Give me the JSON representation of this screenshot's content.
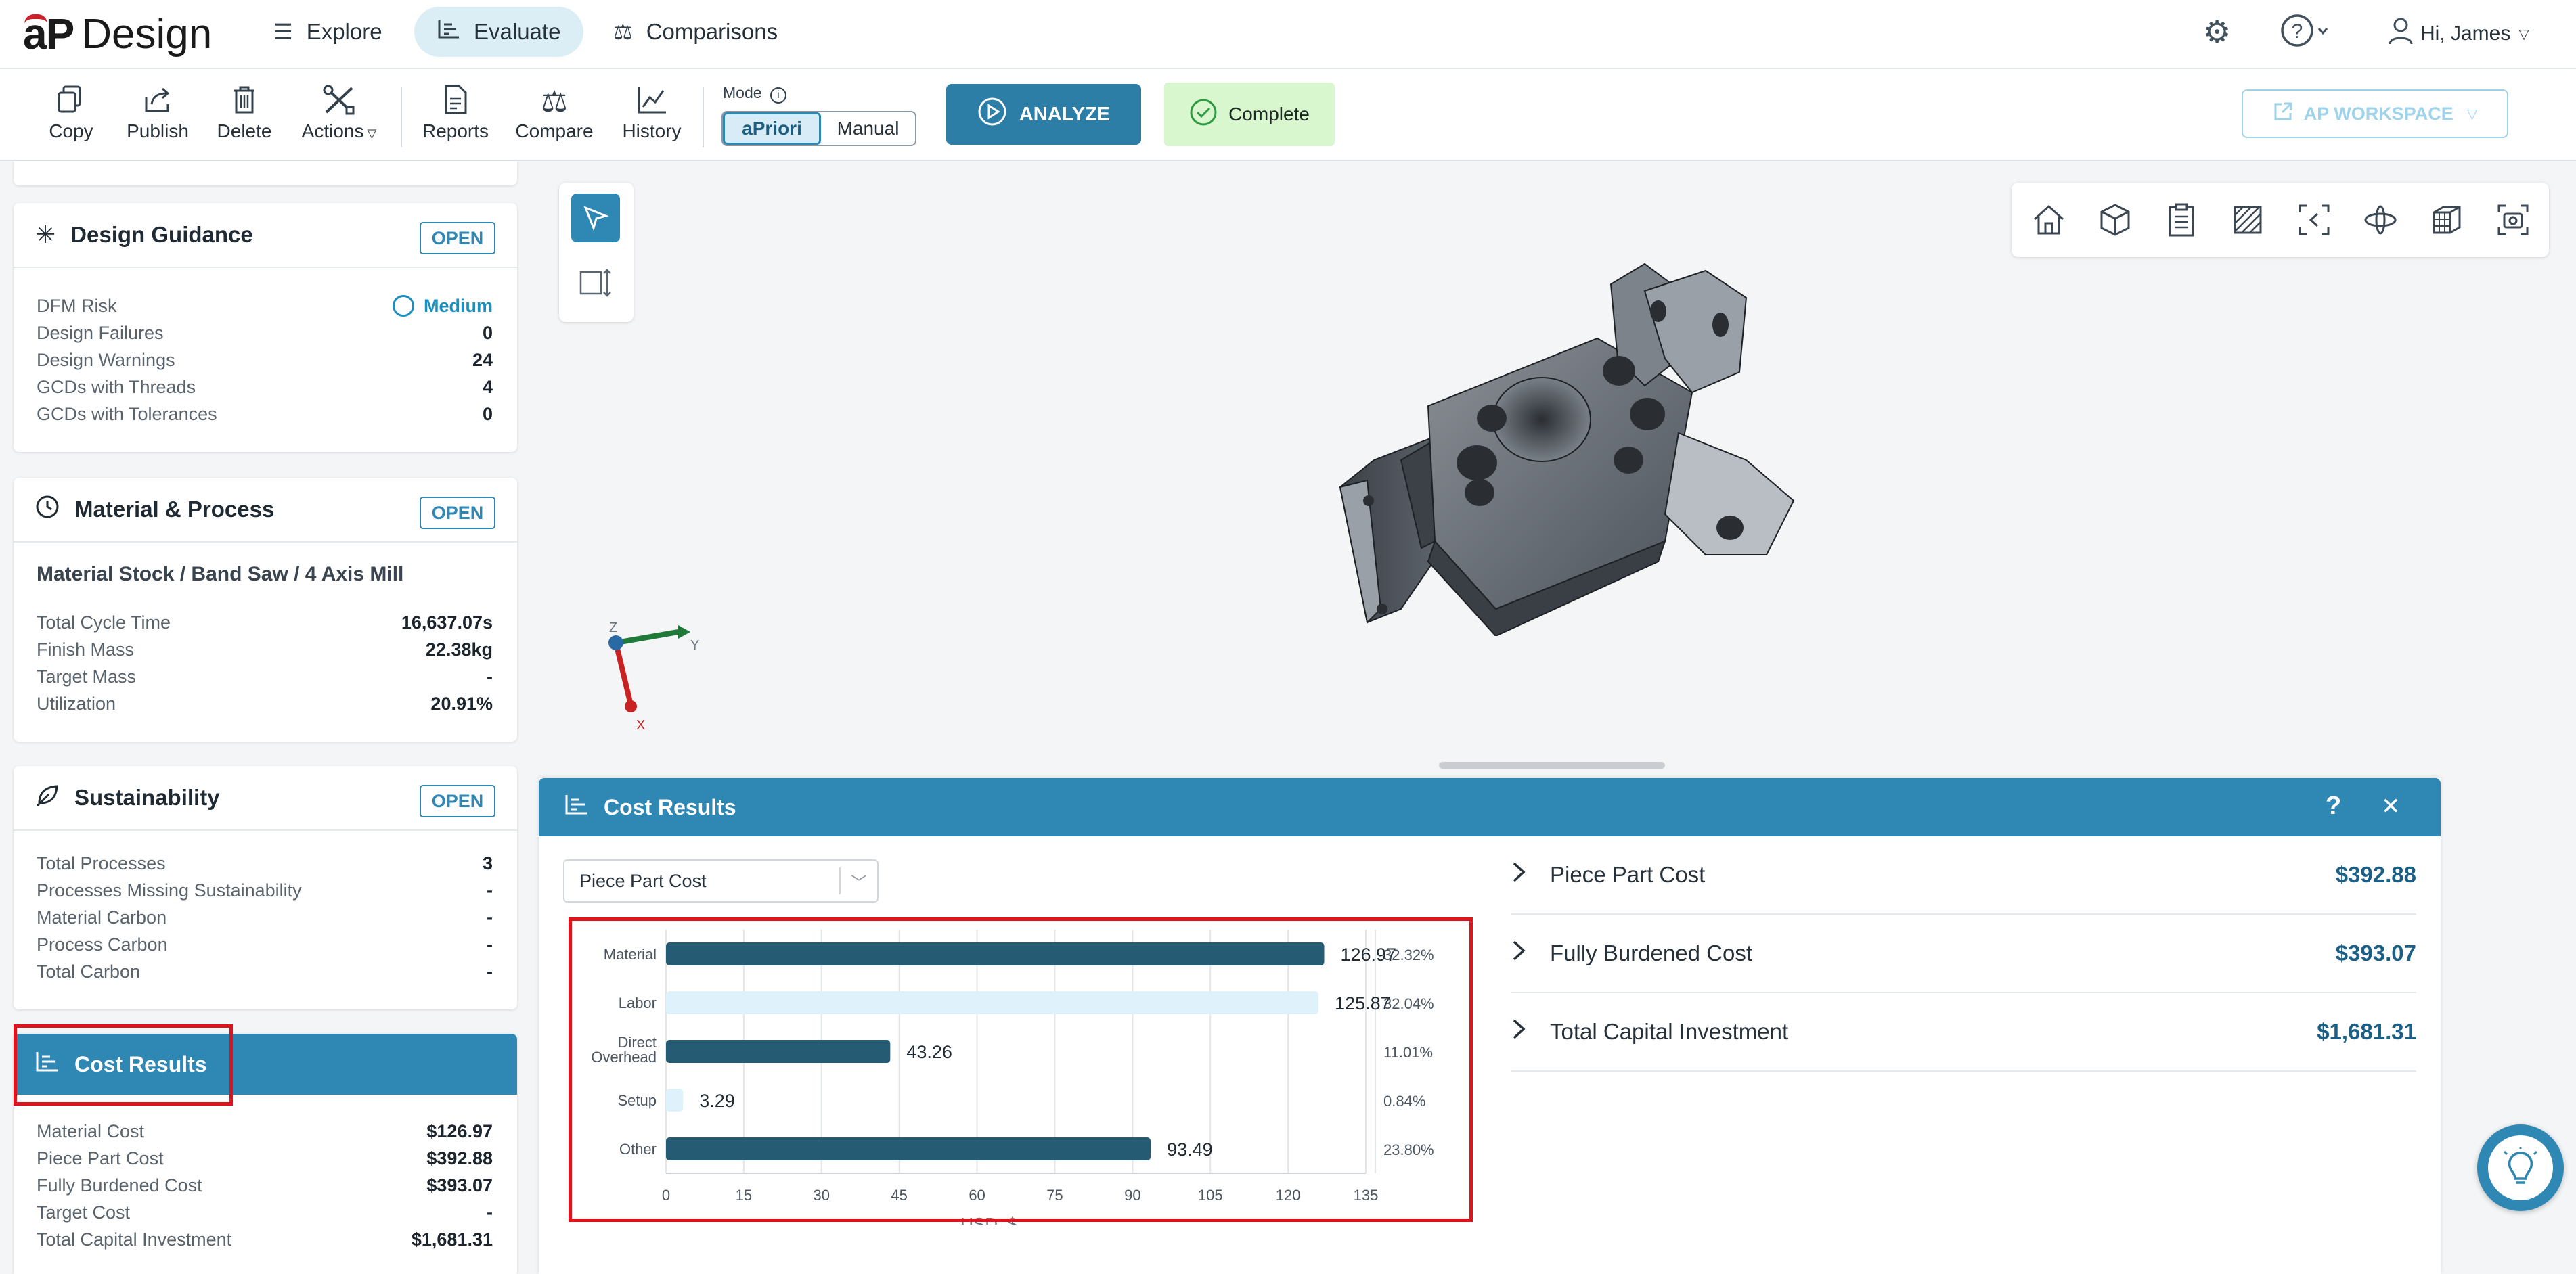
{
  "brand": {
    "logo_mark": "aP",
    "logo_text": "Design"
  },
  "nav": {
    "tabs": [
      {
        "label": "Explore",
        "icon": "list-icon"
      },
      {
        "label": "Evaluate",
        "icon": "chart-icon"
      },
      {
        "label": "Comparisons",
        "icon": "scale-icon"
      }
    ],
    "user_label": "Hi, James"
  },
  "toolbar": {
    "copy": "Copy",
    "publish": "Publish",
    "delete": "Delete",
    "actions": "Actions",
    "reports": "Reports",
    "compare": "Compare",
    "history": "History",
    "mode_label": "Mode",
    "mode_options": [
      "aPriori",
      "Manual"
    ],
    "analyze": "ANALYZE",
    "status": "Complete",
    "workspace": "AP WORKSPACE"
  },
  "design_guidance": {
    "title": "Design Guidance",
    "open": "OPEN",
    "rows": [
      {
        "label": "DFM Risk",
        "value": "Medium"
      },
      {
        "label": "Design Failures",
        "value": "0"
      },
      {
        "label": "Design Warnings",
        "value": "24"
      },
      {
        "label": "GCDs with Threads",
        "value": "4"
      },
      {
        "label": "GCDs with Tolerances",
        "value": "0"
      }
    ]
  },
  "material_process": {
    "title": "Material & Process",
    "open": "OPEN",
    "routing": "Material Stock / Band Saw / 4 Axis Mill",
    "rows": [
      {
        "label": "Total Cycle Time",
        "value": "16,637.07s"
      },
      {
        "label": "Finish Mass",
        "value": "22.38kg"
      },
      {
        "label": "Target Mass",
        "value": "-"
      },
      {
        "label": "Utilization",
        "value": "20.91%"
      }
    ]
  },
  "sustainability": {
    "title": "Sustainability",
    "open": "OPEN",
    "rows": [
      {
        "label": "Total Processes",
        "value": "3"
      },
      {
        "label": "Processes Missing Sustainability",
        "value": "-"
      },
      {
        "label": "Material Carbon",
        "value": "-"
      },
      {
        "label": "Process Carbon",
        "value": "-"
      },
      {
        "label": "Total Carbon",
        "value": "-"
      }
    ]
  },
  "cost_panel": {
    "title": "Cost Results",
    "rows": [
      {
        "label": "Material Cost",
        "value": "$126.97"
      },
      {
        "label": "Piece Part Cost",
        "value": "$392.88"
      },
      {
        "label": "Fully Burdened Cost",
        "value": "$393.07"
      },
      {
        "label": "Target Cost",
        "value": "-"
      },
      {
        "label": "Total Capital Investment",
        "value": "$1,681.31"
      }
    ]
  },
  "viewer": {
    "axis_labels": {
      "x": "X",
      "y": "Y",
      "z": "Z"
    }
  },
  "drawer": {
    "title": "Cost Results",
    "help": "?",
    "close": "✕",
    "select_value": "Piece Part Cost",
    "summary": [
      {
        "label": "Piece Part Cost",
        "value": "$392.88"
      },
      {
        "label": "Fully Burdened Cost",
        "value": "$393.07"
      },
      {
        "label": "Total Capital Investment",
        "value": "$1,681.31"
      }
    ]
  },
  "chart_data": {
    "type": "bar",
    "orientation": "horizontal",
    "categories": [
      "Material",
      "Labor",
      "Direct Overhead",
      "Setup",
      "Other"
    ],
    "values": [
      126.97,
      125.87,
      43.26,
      3.29,
      93.49
    ],
    "value_labels": [
      "126.97",
      "125.87",
      "43.26",
      "3.29",
      "93.49"
    ],
    "percent_labels": [
      "32.32%",
      "32.04%",
      "11.01%",
      "0.84%",
      "23.80%"
    ],
    "xlabel": "USD, $",
    "xticks": [
      0,
      15,
      30,
      45,
      60,
      75,
      90,
      105,
      120,
      135
    ],
    "xlim": [
      0,
      135
    ],
    "grid": true,
    "colors": [
      "#255c74",
      "#dff2fb",
      "#255c74",
      "#dff2fb",
      "#255c74"
    ]
  },
  "colors": {
    "accent": "#2f87b4",
    "status_ok_bg": "#d9f7cf",
    "highlight": "#e0121b",
    "bar_dark": "#255c74",
    "bar_light": "#dff2fb"
  }
}
